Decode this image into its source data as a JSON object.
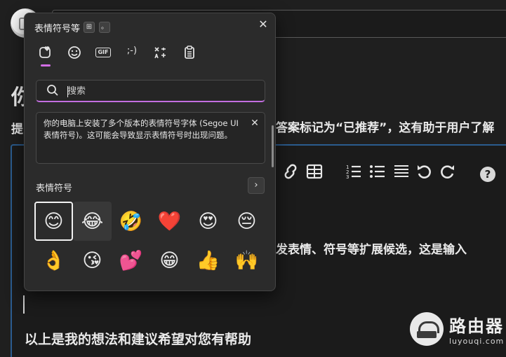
{
  "background": {
    "heading_partial": "你",
    "line_left_partial": "提",
    "line_right_partial": "答案标记为“已推荐”，这有助于用户了解",
    "paragraph_partial": "发表情、符号等扩展候选，这是输入",
    "closing": "以上是我的想法和建议希望对您有帮助",
    "toolbar_icons": [
      "link-icon",
      "table-icon",
      "numbered-list-icon",
      "bullet-list-icon",
      "align-icon",
      "undo-icon",
      "redo-icon",
      "help-icon"
    ],
    "help_glyph": "?"
  },
  "watermark": {
    "title": "路由器",
    "subtitle": "luyouqi.com"
  },
  "panel": {
    "title": "表情符号等",
    "hint_key_windows": "⊞",
    "hint_key_period": "。",
    "close_glyph": "✕",
    "tabs": [
      {
        "name": "tab-emoji",
        "glyph": "♥",
        "active": true
      },
      {
        "name": "tab-kaomoji-face",
        "glyph": "☺",
        "active": false
      },
      {
        "name": "tab-gif",
        "glyph": "GIF",
        "active": false
      },
      {
        "name": "tab-kaomoji",
        "glyph": ";-)",
        "active": false
      },
      {
        "name": "tab-symbols",
        "glyph": "⚹",
        "active": false
      },
      {
        "name": "tab-clipboard",
        "glyph": "▤",
        "active": false
      }
    ],
    "search_placeholder": "搜索",
    "notice": "你的电脑上安装了多个版本的表情符号字体 (Segoe UI表情符号)。这可能会导致显示表情符号时出现问题。",
    "notice_close_glyph": "✕",
    "section_label": "表情符号",
    "section_next_glyph": "›",
    "emojis": [
      "😊",
      "😂",
      "🤣",
      "❤️",
      "😍",
      "😔",
      "👌",
      "😘",
      "💕",
      "😁",
      "👍",
      "🙌"
    ],
    "selected_index": 0,
    "hovered_index": 1
  }
}
